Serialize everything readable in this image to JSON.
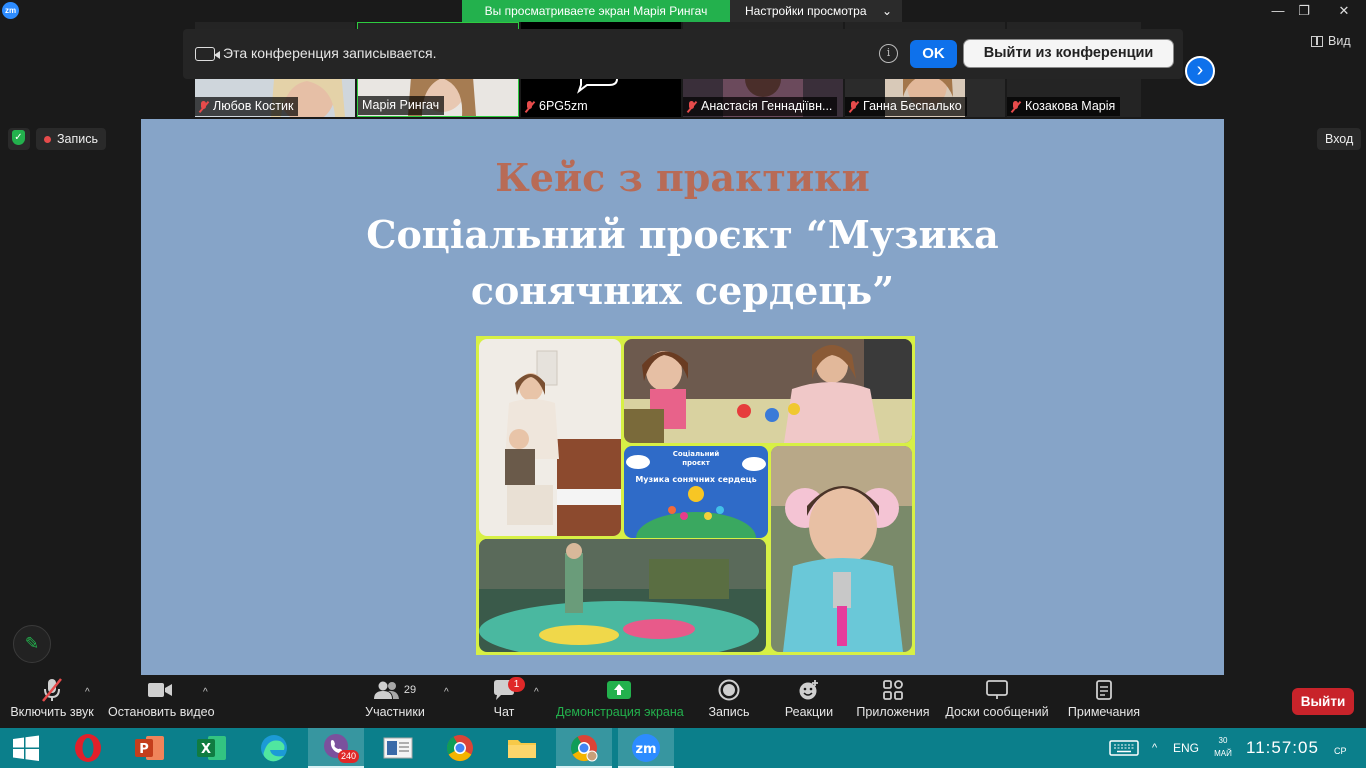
{
  "titlebar": {
    "share_banner": "Вы просматриваете экран Марія Рингач",
    "view_settings": "Настройки просмотра",
    "chevron": "⌄",
    "minimize": "—",
    "restore": "❐",
    "close": "✕",
    "logo": "zm"
  },
  "thumbnails": [
    {
      "name": "Любов Костик",
      "muted": true
    },
    {
      "name": "Марія Рингач",
      "muted": false
    },
    {
      "name": "6PG5zm",
      "muted": true
    },
    {
      "name": "Анастасія Геннадіївн...",
      "muted": true
    },
    {
      "name": "Ганна Беспалько",
      "muted": true
    },
    {
      "name": "Козакова Марія",
      "muted": true
    }
  ],
  "recording_notice": {
    "text": "Эта конференция записывается.",
    "info": "i",
    "ok": "OK",
    "leave": "Выйти из конференции",
    "next": "›"
  },
  "view_button": "Вид",
  "record_status": "Запись",
  "entry_button": "Вход",
  "slide": {
    "title": "Кейс з практики",
    "subtitle": "Соціальний проєкт “Музика сонячних сердець”",
    "logo_line1": "Соціальний",
    "logo_line2": "проєкт",
    "logo_line3": "Музика сонячних сердець"
  },
  "toolbar": {
    "unmute": "Включить звук",
    "stop_video": "Остановить видео",
    "participants": "Участники",
    "participants_count": "29",
    "chat": "Чат",
    "chat_badge": "1",
    "share": "Демонстрация экрана",
    "record": "Запись",
    "reactions": "Реакции",
    "apps": "Приложения",
    "whiteboards": "Доски сообщений",
    "notes": "Примечания",
    "exit": "Выйти",
    "caret": "^"
  },
  "taskbar": {
    "viber_badge": "240",
    "lang": "ENG",
    "date_top": "30",
    "date_bottom": "МАЙ",
    "time": "11:57:05",
    "day": "СР",
    "zoom_label": "zm",
    "tray_arrow": "^"
  },
  "colors": {
    "accent_blue": "#0e71eb",
    "share_green": "#23b14d",
    "exit_red": "#c8232a",
    "slide_bg": "#86a4c8",
    "slide_title": "#b86b56",
    "collage_frame": "#d7f045",
    "taskbar": "#0b7f8b"
  }
}
